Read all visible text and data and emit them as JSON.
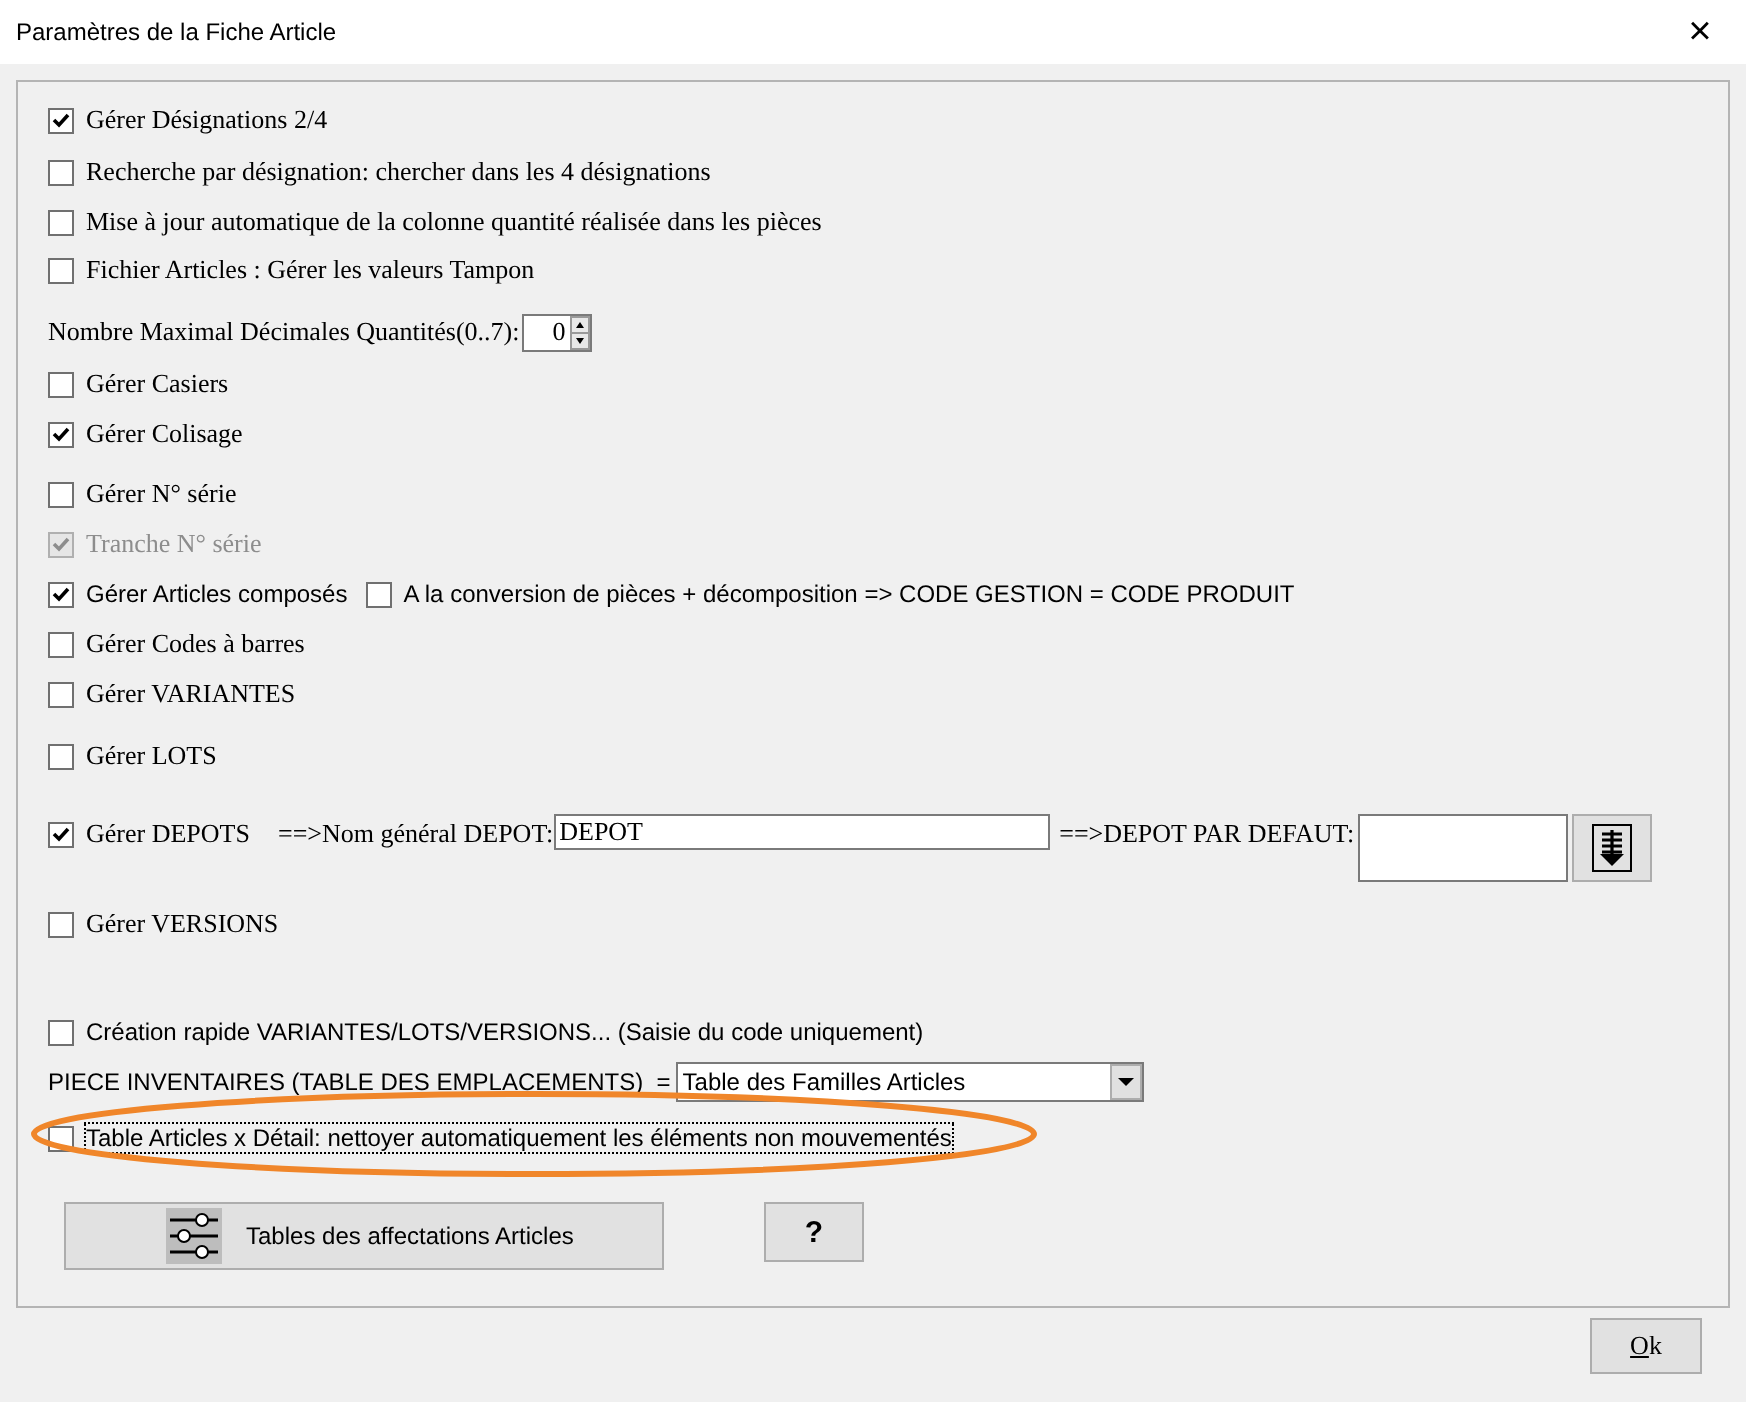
{
  "window": {
    "title": "Paramètres de la Fiche Article",
    "close": "×"
  },
  "items": [
    {
      "kind": "checkbox",
      "label": "Gérer Désignations 2/4",
      "checked": true,
      "disabled": false
    },
    {
      "kind": "checkbox",
      "label": "Recherche par désignation: chercher dans les 4 désignations",
      "checked": false,
      "disabled": false
    },
    {
      "kind": "checkbox",
      "label": "Mise à jour automatique de la colonne quantité réalisée dans les pièces",
      "checked": false,
      "disabled": false
    },
    {
      "kind": "checkbox",
      "label": "Fichier Articles : Gérer les valeurs Tampon",
      "checked": false,
      "disabled": false
    },
    {
      "kind": "spinner",
      "label": "Nombre Maximal Décimales Quantités(0..7):",
      "value": "0"
    },
    {
      "kind": "checkbox",
      "label": "Gérer Casiers",
      "checked": false,
      "disabled": false
    },
    {
      "kind": "checkbox",
      "label": "Gérer Colisage",
      "checked": true,
      "disabled": false
    },
    {
      "kind": "checkbox",
      "label": "Gérer N° série",
      "checked": false,
      "disabled": false
    },
    {
      "kind": "checkbox",
      "label": "Tranche N° série",
      "checked": true,
      "disabled": true
    },
    {
      "kind": "checkbox",
      "label": "Gérer Articles composés",
      "checked": true,
      "disabled": false,
      "extra": {
        "label": "A la conversion de pièces + décomposition => CODE GESTION = CODE PRODUIT",
        "checked": false
      }
    },
    {
      "kind": "checkbox",
      "label": "Gérer Codes à barres",
      "checked": false,
      "disabled": false
    },
    {
      "kind": "checkbox",
      "label": "Gérer VARIANTES",
      "checked": false,
      "disabled": false
    },
    {
      "kind": "checkbox",
      "label": "Gérer LOTS",
      "checked": false,
      "disabled": false
    },
    {
      "kind": "depot",
      "label": "Gérer DEPOTS",
      "checked": true,
      "name_label": "==>Nom général DEPOT:",
      "name_value": "DEPOT",
      "default_label": "==>DEPOT PAR DEFAUT:"
    },
    {
      "kind": "checkbox",
      "label": "Gérer VERSIONS",
      "checked": false,
      "disabled": false
    },
    {
      "kind": "checkbox",
      "label": "Création rapide VARIANTES/LOTS/VERSIONS... (Saisie du code uniquement)",
      "checked": false,
      "disabled": false
    },
    {
      "kind": "select",
      "label": "PIECE INVENTAIRES (TABLE DES EMPLACEMENTS)  =",
      "value": "Table des Familles Articles"
    },
    {
      "kind": "checkbox",
      "label": "Table Articles x Détail: nettoyer automatiquement les éléments non mouvementés",
      "checked": false,
      "disabled": false,
      "focused": true,
      "highlighted": true
    },
    {
      "kind": "buttons",
      "buttons": [
        {
          "label": "Tables des affectations Articles",
          "icon": true
        },
        {
          "label": "?",
          "icon": false
        }
      ]
    }
  ],
  "footer": {
    "ok_mnemonic": "O",
    "ok_rest": "k"
  }
}
